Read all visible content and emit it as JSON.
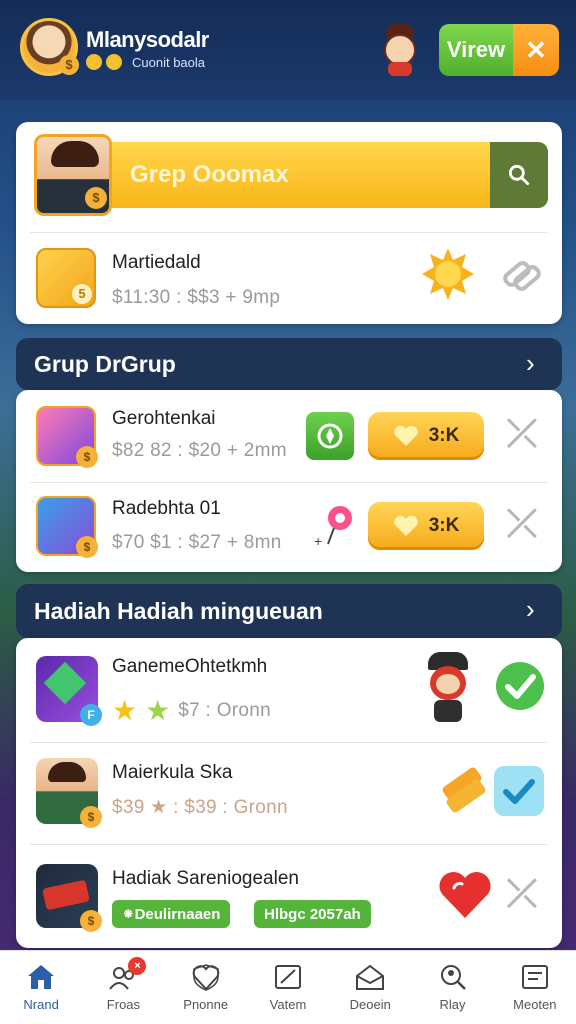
{
  "header": {
    "app_title": "Mlanysodalr",
    "subtitle": "Cuonit baola",
    "view_button": "Virew",
    "close_button": "✕"
  },
  "search_card": {
    "placeholder": "Grep Ooomax",
    "coin_symbol": "$",
    "item": {
      "title": "Martiedald",
      "meta": "$11:30 : $$3 + 9mp",
      "badge_number": "5"
    }
  },
  "group_section": {
    "title": "Grup DrGrup",
    "rows": [
      {
        "title": "Gerohtenkai",
        "meta": "$82 82 : $20 + 2mm",
        "action_label": "3:K",
        "coin": "$"
      },
      {
        "title": "Radebhta 01",
        "meta": "$70 $1 : $27 + 8mn",
        "action_label": "3:K",
        "coin": "$"
      }
    ]
  },
  "rewards_section": {
    "title": "Hadiah Hadiah mingueuan",
    "rows": [
      {
        "title": "GanemeOhtetkmh",
        "meta": "$7 : Oronn",
        "icon_letter": "F"
      },
      {
        "title": "Maierkula Ska",
        "meta": "$39 ★ : $39 : Gronn",
        "coin": "$"
      },
      {
        "title": "Hadiak Sareniogealen",
        "tag1": "⁕Deulirnaaen",
        "tag2": "Hlbgc 2057ah",
        "coin": "$"
      }
    ]
  },
  "bottom_nav": {
    "items": [
      {
        "label": "Nrand",
        "icon": "home-icon",
        "active": true
      },
      {
        "label": "Froas",
        "icon": "friends-icon",
        "badge": "×"
      },
      {
        "label": "Pnonne",
        "icon": "heart-shield-icon"
      },
      {
        "label": "Vatem",
        "icon": "edit-icon"
      },
      {
        "label": "Deoein",
        "icon": "inbox-icon"
      },
      {
        "label": "Rlay",
        "icon": "search-people-icon"
      },
      {
        "label": "Meoten",
        "icon": "profile-card-icon"
      }
    ]
  },
  "colors": {
    "accent_gold": "#f9b61a",
    "accent_green": "#4fb02c",
    "accent_orange": "#f58f12",
    "header_bg": "#142c57",
    "nav_active": "#2b5fa8"
  }
}
